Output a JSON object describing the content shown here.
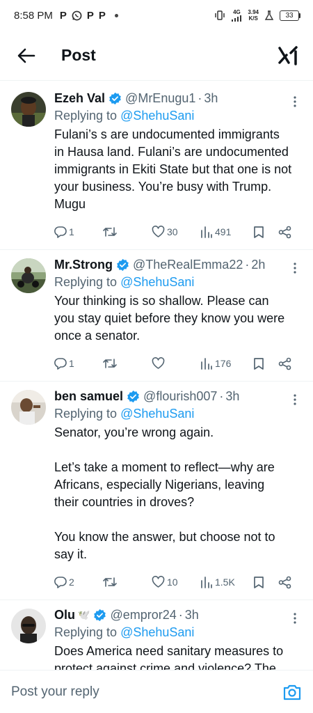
{
  "status_bar": {
    "time": "8:58 PM",
    "notif_icons": [
      "P",
      "whatsapp-icon",
      "P",
      "P"
    ],
    "network_type": "4G",
    "speed_value": "3.94",
    "speed_unit": "K/S",
    "battery": "33"
  },
  "header": {
    "title": "Post"
  },
  "tweets": [
    {
      "name": "Ezeh Val",
      "handle": "@MrEnugu1",
      "time": "3h",
      "replying_prefix": "Replying to ",
      "replying_to": "@ShehuSani",
      "text": "Fulani’s s are undocumented immigrants in Hausa land. Fulani’s are undocumented immigrants in Ekiti State but that one is not your business. You’re busy with Trump. Mugu",
      "replies": "1",
      "retweets": "",
      "likes": "30",
      "views": "491"
    },
    {
      "name": "Mr.Strong",
      "handle": "@TheRealEmma22",
      "time": "2h",
      "replying_prefix": "Replying to ",
      "replying_to": "@ShehuSani",
      "text": "Your thinking is so shallow. Please can you stay quiet before they know you were once a senator.",
      "replies": "1",
      "retweets": "",
      "likes": "",
      "views": "176"
    },
    {
      "name": "ben samuel",
      "handle": "@flourish007",
      "time": "3h",
      "replying_prefix": "Replying to ",
      "replying_to": "@ShehuSani",
      "text": "Senator, you’re wrong again.\n\nLet’s take a moment to reflect—why are Africans, especially Nigerians, leaving their countries in droves?\n\nYou know the answer, but choose not to say it.",
      "replies": "2",
      "retweets": "",
      "likes": "10",
      "views": "1.5K"
    },
    {
      "name": "Olu",
      "name_emoji": "🕊️",
      "handle": "@empror24",
      "time": "3h",
      "replying_prefix": "Replying to ",
      "replying_to": "@ShehuSani",
      "text": "Does America need sanitary measures to protect against crime and violence? The"
    }
  ],
  "composer": {
    "placeholder": "Post your reply"
  },
  "colors": {
    "accent": "#1d9bf0",
    "secondary_text": "#536471",
    "primary_text": "#0f1419"
  }
}
